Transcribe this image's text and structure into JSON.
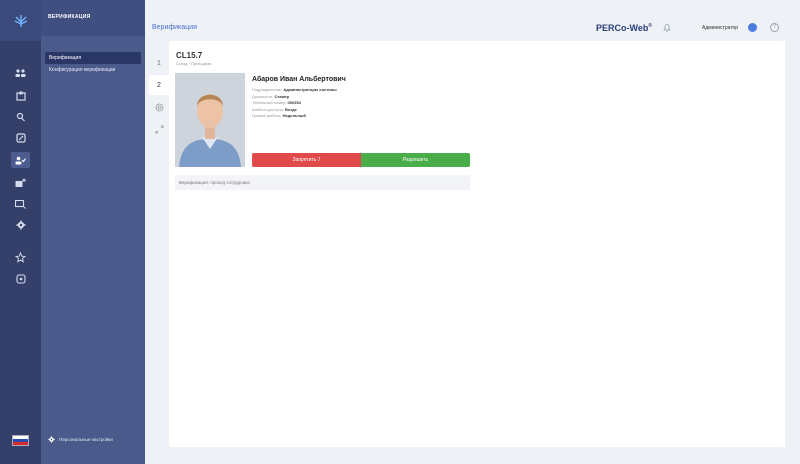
{
  "sidebar": {
    "title": "ВЕРИФИКАЦИЯ",
    "items": [
      {
        "label": "Верификация",
        "active": true
      },
      {
        "label": "Конфигурация верификации",
        "active": false
      }
    ],
    "personal_settings": "Персональные настройки"
  },
  "rail": {
    "icons": [
      "logo-icon",
      "people-icon",
      "badge-icon",
      "key-icon",
      "card-icon",
      "verification-icon",
      "user-add-icon",
      "monitor-icon",
      "gear-icon",
      "star-icon",
      "app-icon"
    ],
    "active": "verification-icon"
  },
  "header": {
    "breadcrumb": "Верификация",
    "brand": "PERCo-Web",
    "brand_mark": "®",
    "user": "Администратор",
    "help": "?"
  },
  "steps": [
    "1",
    "2"
  ],
  "device": {
    "title": "CL15.7",
    "subtitle": "Склад › Проходная"
  },
  "employee": {
    "name": "Абаров Иван Альбертович",
    "fields": [
      {
        "label": "Подразделение:",
        "value": "Администраторы системы"
      },
      {
        "label": "Должность:",
        "value": "Стажер"
      },
      {
        "label": "Табельный номер:",
        "value": "000354"
      },
      {
        "label": "Шаблон доступа:",
        "value": "Везде"
      },
      {
        "label": "График работы:",
        "value": "Недельный"
      }
    ]
  },
  "actions": {
    "deny": "Запретить 7",
    "allow": "Разрешить"
  },
  "log": "Верификация: проход сотрудника",
  "colors": {
    "rail": "#34406a",
    "sidebar": "#4a5a8a",
    "deny": "#e04a4a",
    "allow": "#49ad49",
    "link": "#4a6fd0"
  }
}
